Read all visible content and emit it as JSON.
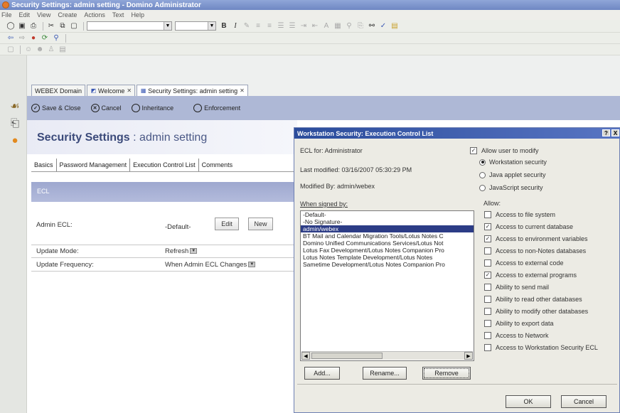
{
  "window": {
    "title": "Security Settings: admin setting - Domino Administrator"
  },
  "menu": [
    "File",
    "Edit",
    "View",
    "Create",
    "Actions",
    "Text",
    "Help"
  ],
  "tabs": [
    {
      "label": "WEBEX Domain"
    },
    {
      "label": "Welcome"
    },
    {
      "label": "Security Settings: admin setting"
    }
  ],
  "actions": {
    "save_close": "Save & Close",
    "cancel": "Cancel",
    "inheritance": "Inheritance",
    "enforcement": "Enforcement"
  },
  "form": {
    "title_main": "Security Settings",
    "title_sep": " : ",
    "title_sub": "admin setting",
    "tabs": [
      "Basics",
      "Password Management",
      "Execution Control List",
      "Comments"
    ],
    "section": "ECL",
    "admin_ecl_label": "Admin ECL:",
    "admin_ecl_value": "-Default-",
    "edit_button": "Edit",
    "new_button": "New",
    "update_mode_label": "Update Mode:",
    "update_mode_value": "Refresh",
    "update_freq_label": "Update Frequency:",
    "update_freq_value": "When Admin ECL Changes"
  },
  "dialog": {
    "title": "Workstation Security: Execution Control List",
    "ecl_for": "ECL for:  Administrator",
    "last_modified": "Last modified: 03/16/2007 05:30:29 PM",
    "modified_by": "Modified By: admin/webex",
    "when_signed_by": "When signed by:",
    "signers": [
      "-Default-",
      "-No Signature-",
      "admin/webex",
      "BT Mail and Calendar Migration Tools/Lotus Notes C",
      "Domino Unified Communications Services/Lotus Not",
      "Lotus Fax Development/Lotus Notes Companion Pro",
      "Lotus Notes Template Development/Lotus Notes",
      "Sametime Development/Lotus Notes Companion Pro"
    ],
    "selected_index": 2,
    "allow_user_modify": "Allow user to modify",
    "security_types": [
      "Workstation security",
      "Java applet security",
      "JavaScript security"
    ],
    "selected_security": 0,
    "allow_label": "Allow:",
    "allow_items": [
      {
        "label": "Access to file system",
        "checked": false
      },
      {
        "label": "Access to current database",
        "checked": true
      },
      {
        "label": "Access to environment variables",
        "checked": true
      },
      {
        "label": "Access to non-Notes databases",
        "checked": false
      },
      {
        "label": "Access to external code",
        "checked": false
      },
      {
        "label": "Access to external programs",
        "checked": true
      },
      {
        "label": "Ability to send mail",
        "checked": false
      },
      {
        "label": "Ability to read other databases",
        "checked": false
      },
      {
        "label": "Ability to modify other databases",
        "checked": false
      },
      {
        "label": "Ability to export data",
        "checked": false
      },
      {
        "label": "Access to Network",
        "checked": false
      },
      {
        "label": "Access to Workstation Security ECL",
        "checked": false
      }
    ],
    "buttons": {
      "add": "Add...",
      "rename": "Rename...",
      "remove": "Remove",
      "ok": "OK",
      "cancel": "Cancel"
    },
    "help_glyph": "?",
    "close_glyph": "X"
  }
}
